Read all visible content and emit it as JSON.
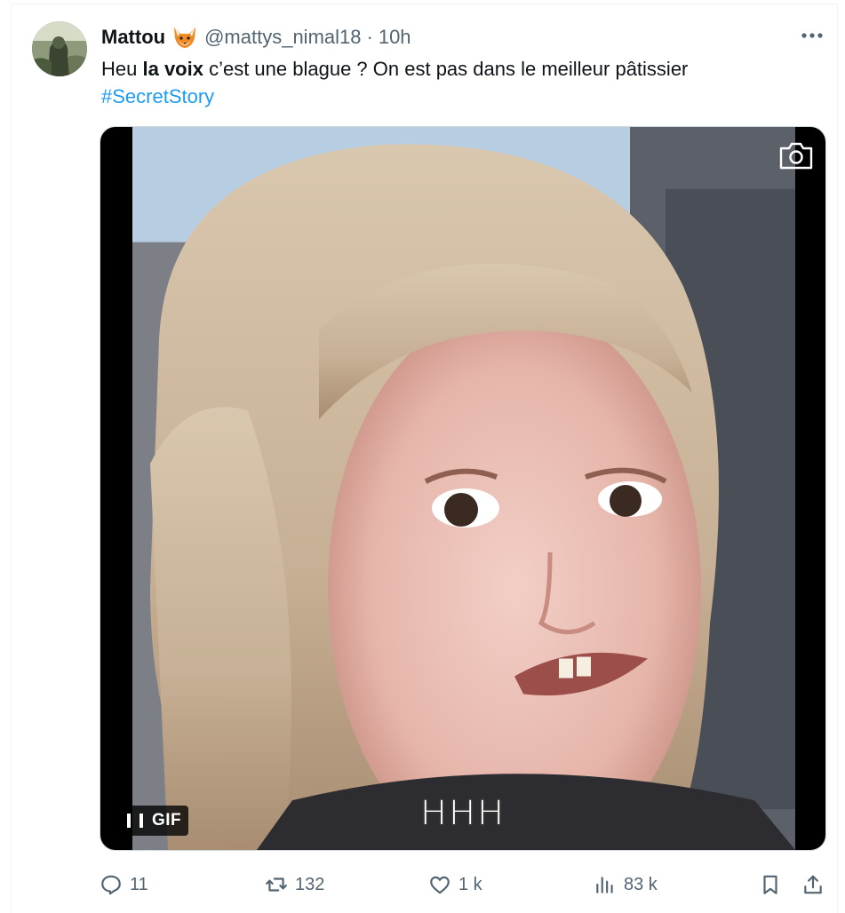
{
  "tweet": {
    "author_name": "Mattou",
    "author_emoji": "fox-emoji",
    "handle": "@mattys_nimal18",
    "separator": "·",
    "time": "10h",
    "text_part1": "Heu ",
    "text_bold": "la voix",
    "text_part2": " c’est une blague ? On est pas dans le meilleur pâtissier",
    "hashtag": "#SecretStory",
    "more_icon": "more-icon"
  },
  "media": {
    "type": "gif",
    "gif_label": "GIF",
    "subtitle": "HHH",
    "camera_icon": "camera-icon",
    "pause_icon": "pause-icon"
  },
  "actions": {
    "replies": "11",
    "retweets": "132",
    "likes": "1 k",
    "views": "83 k"
  },
  "colors": {
    "link": "#1d9bf0",
    "muted": "#536471",
    "text": "#0f1419"
  }
}
